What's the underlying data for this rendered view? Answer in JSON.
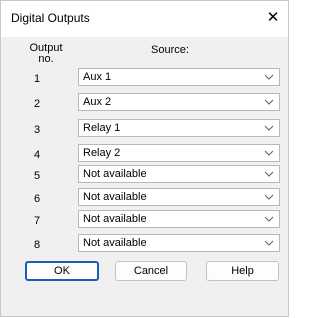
{
  "window": {
    "title": "Digital Outputs",
    "close_glyph": "✕"
  },
  "headers": {
    "output_line1": "Output",
    "output_line2": "no.",
    "source": "Source:"
  },
  "rows": [
    {
      "number": "1",
      "source": "Aux 1"
    },
    {
      "number": "2",
      "source": "Aux 2"
    },
    {
      "number": "3",
      "source": "Relay 1"
    },
    {
      "number": "4",
      "source": "Relay 2"
    },
    {
      "number": "5",
      "source": "Not available"
    },
    {
      "number": "6",
      "source": "Not available"
    },
    {
      "number": "7",
      "source": "Not available"
    },
    {
      "number": "8",
      "source": "Not available"
    }
  ],
  "buttons": {
    "ok": "OK",
    "cancel": "Cancel",
    "help": "Help"
  },
  "icons": {
    "close": "close-icon",
    "dropdown": "chevron-down-icon"
  },
  "colors": {
    "default_button_border": "#1a5fb4",
    "dialog_background": "#f0f0f0"
  }
}
